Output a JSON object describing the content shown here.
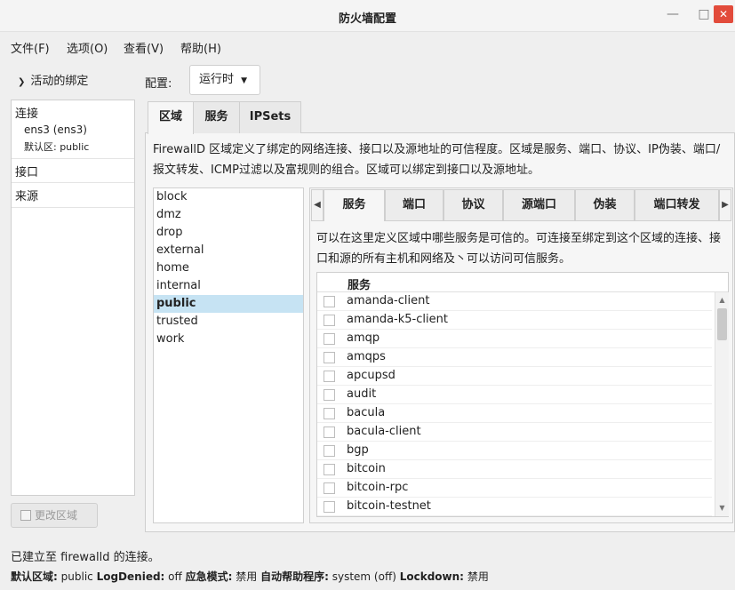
{
  "window": {
    "title": "防火墙配置",
    "minimize": "—",
    "maximize": "□",
    "close": "✕"
  },
  "menu": [
    "文件(F)",
    "选项(O)",
    "查看(V)",
    "帮助(H)"
  ],
  "left": {
    "toggle_label": "活动的绑定",
    "connections_header": "连接",
    "connection_item": "ens3 (ens3)",
    "connection_zone": "默认区: public",
    "interfaces_header": "接口",
    "sources_header": "来源",
    "change_zone_button": "更改区域"
  },
  "config": {
    "label": "配置:",
    "value": "运行时"
  },
  "tabs": [
    "区域",
    "服务",
    "IPSets"
  ],
  "zone_description": "FirewallD 区域定义了绑定的网络连接、接口以及源地址的可信程度。区域是服务、端口、协议、IP伪装、端口/报文转发、ICMP过滤以及富规则的组合。区域可以绑定到接口以及源地址。",
  "zones": [
    "block",
    "dmz",
    "drop",
    "external",
    "home",
    "internal",
    "public",
    "trusted",
    "work"
  ],
  "selected_zone": "public",
  "inner_tabs": [
    "服务",
    "端口",
    "协议",
    "源端口",
    "伪装",
    "端口转发"
  ],
  "services_description": "可以在这里定义区域中哪些服务是可信的。可连接至绑定到这个区域的连接、接口和源的所有主机和网络及丶可以访问可信服务。",
  "services_header": "服务",
  "services": [
    "amanda-client",
    "amanda-k5-client",
    "amqp",
    "amqps",
    "apcupsd",
    "audit",
    "bacula",
    "bacula-client",
    "bgp",
    "bitcoin",
    "bitcoin-rpc",
    "bitcoin-testnet"
  ],
  "status": {
    "connection": "已建立至 firewalld 的连接。",
    "default_zone_label": "默认区域:",
    "default_zone_value": "public",
    "log_denied_label": "LogDenied:",
    "log_denied_value": "off",
    "panic_label": "应急模式:",
    "panic_value": "禁用",
    "helper_label": "自动帮助程序:",
    "helper_value": "system (off)",
    "lockdown_label": "Lockdown:",
    "lockdown_value": "禁用"
  },
  "colors": {
    "selection": "#c6e3f3",
    "close_button": "#e24b3b"
  }
}
